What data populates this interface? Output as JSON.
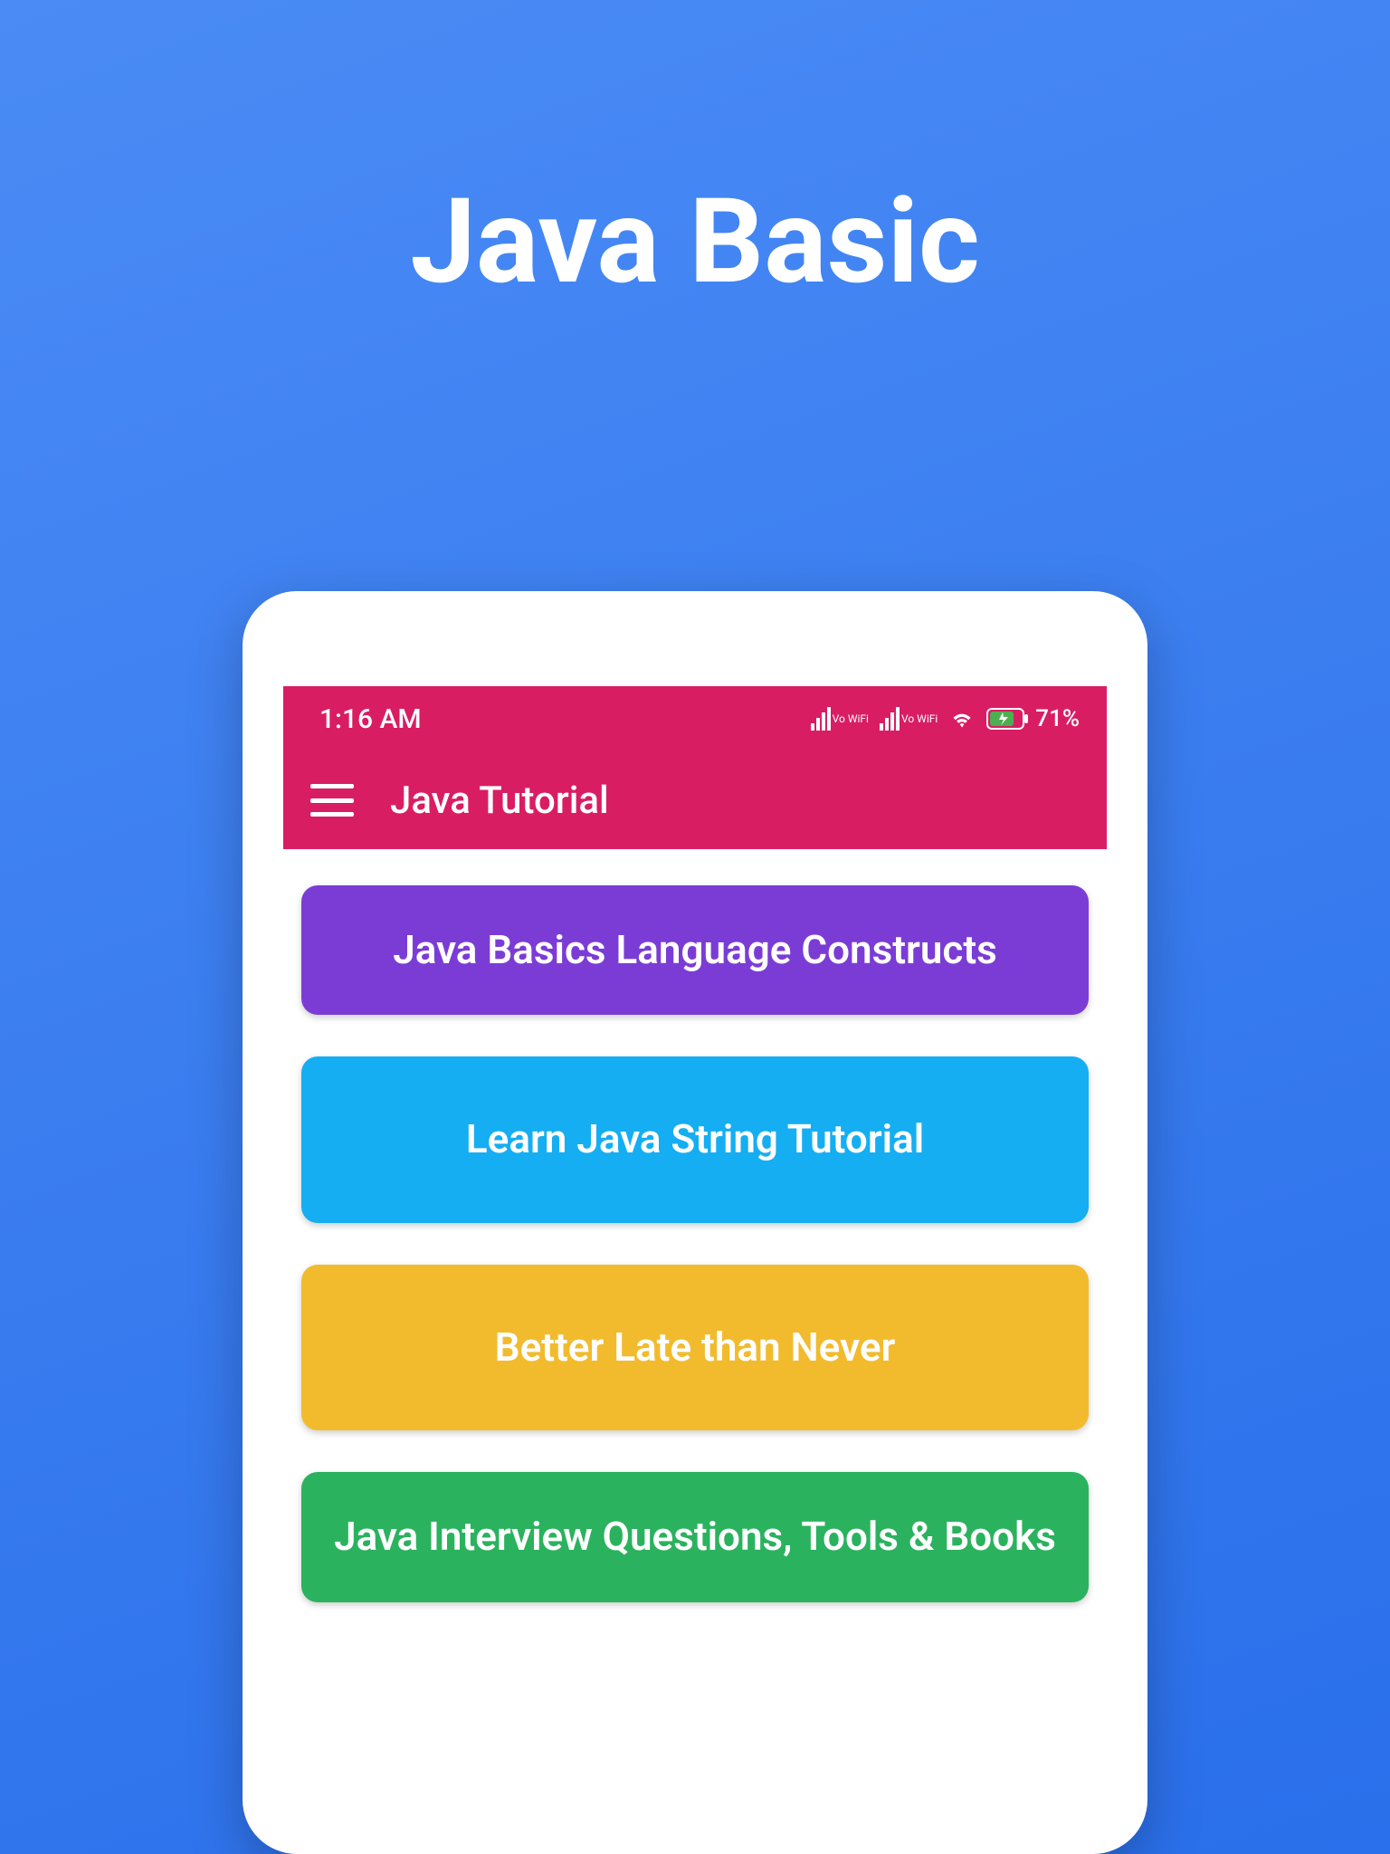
{
  "page": {
    "title": "Java Basic"
  },
  "statusBar": {
    "time": "1:16 AM",
    "signal1Label": "Vo WiFi",
    "signal2Label": "Vo WiFi",
    "batteryPercent": "71%"
  },
  "appBar": {
    "title": "Java Tutorial"
  },
  "menu": {
    "items": [
      {
        "label": "Java Basics Language Constructs",
        "colorClass": "menu-purple"
      },
      {
        "label": "Learn Java String Tutorial",
        "colorClass": "menu-blue"
      },
      {
        "label": "Better Late than Never",
        "colorClass": "menu-yellow"
      },
      {
        "label": "Java Interview Questions, Tools & Books",
        "colorClass": "menu-green"
      }
    ]
  }
}
